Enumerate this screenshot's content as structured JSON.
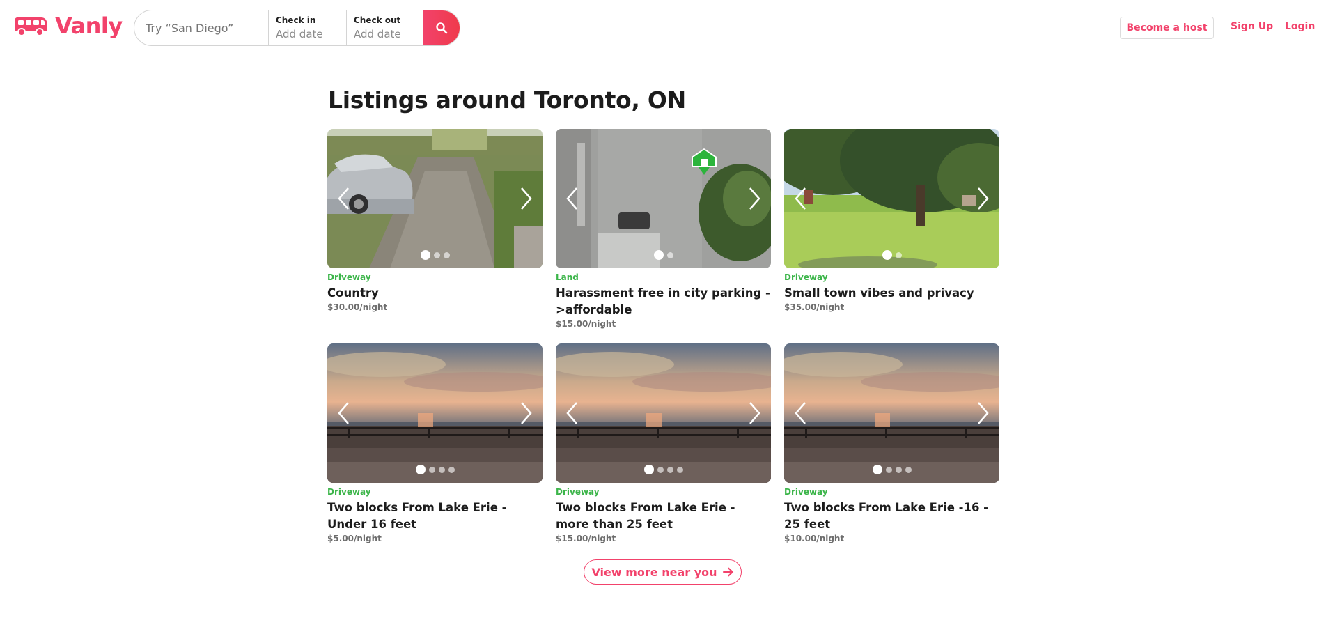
{
  "brand": {
    "name": "Vanly",
    "accent": "#f2426b",
    "logo_icon": "van-icon"
  },
  "search": {
    "where_placeholder": "Try “San Diego”",
    "checkin_label": "Check in",
    "checkin_value": "Add date",
    "checkout_label": "Check out",
    "checkout_value": "Add date",
    "button_icon": "search-icon"
  },
  "nav": {
    "host": "Become a host",
    "signup": "Sign Up",
    "login": "Login"
  },
  "main": {
    "title": "Listings around Toronto, ON",
    "type_color": "#3cb54a",
    "listings": [
      {
        "type": "Driveway",
        "name": "Country",
        "price": "$30.00/night",
        "images": 3,
        "active_image": 1
      },
      {
        "type": "Land",
        "name": "Harassment free in city parking - >affordable",
        "price": "$15.00/night",
        "images": 2,
        "active_image": 1
      },
      {
        "type": "Driveway",
        "name": "Small town vibes and privacy",
        "price": "$35.00/night",
        "images": 2,
        "active_image": 1
      },
      {
        "type": "Driveway",
        "name": "Two blocks From Lake Erie - Under 16 feet",
        "price": "$5.00/night",
        "images": 4,
        "active_image": 1
      },
      {
        "type": "Driveway",
        "name": "Two blocks From Lake Erie - more than 25 feet",
        "price": "$15.00/night",
        "images": 4,
        "active_image": 1
      },
      {
        "type": "Driveway",
        "name": "Two blocks From Lake Erie -16 - 25 feet",
        "price": "$10.00/night",
        "images": 4,
        "active_image": 1
      }
    ],
    "view_more": "View more near you",
    "view_more_icon": "arrow-right-icon"
  }
}
